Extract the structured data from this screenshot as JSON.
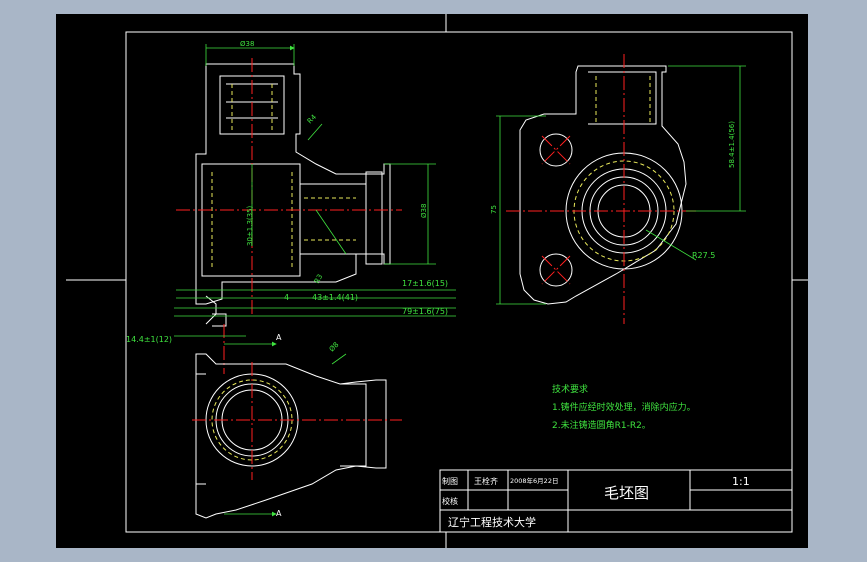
{
  "colors": {
    "background": "#a9b6c7",
    "canvas": "#000000",
    "outline": "#ffffff",
    "dimension": "#3fe23f",
    "centerline": "#ff2020",
    "hidden": "#e8e85a"
  },
  "dimensions": {
    "top_width": "Ø38",
    "radius_top": "R4",
    "vertical_left": "30±1.3(35)",
    "bore": "Ø38",
    "angle_note": "R3",
    "small_4": "4",
    "d43": "43±1.4(41)",
    "d17": "17±1.6(15)",
    "d79": "79±1.6(75)",
    "d14": "14.4±1(12)",
    "phi": "Ø8",
    "section_a_top": "A",
    "section_a_bottom": "A",
    "d75": "75",
    "d58": "58.4±1.4(56)",
    "r27": "R27.5"
  },
  "notes": {
    "title": "技术要求",
    "line1": "1.铸件应经时效处理，消除内应力。",
    "line2": "2.未注铸造圆角R1-R2。"
  },
  "title_block": {
    "drawn_label": "制图",
    "drawn_name": "王栓齐",
    "drawn_date": "2008年6月22日",
    "checked_label": "校核",
    "drawing_name": "毛坯图",
    "scale": "1:1",
    "school": "辽宁工程技术大学"
  }
}
